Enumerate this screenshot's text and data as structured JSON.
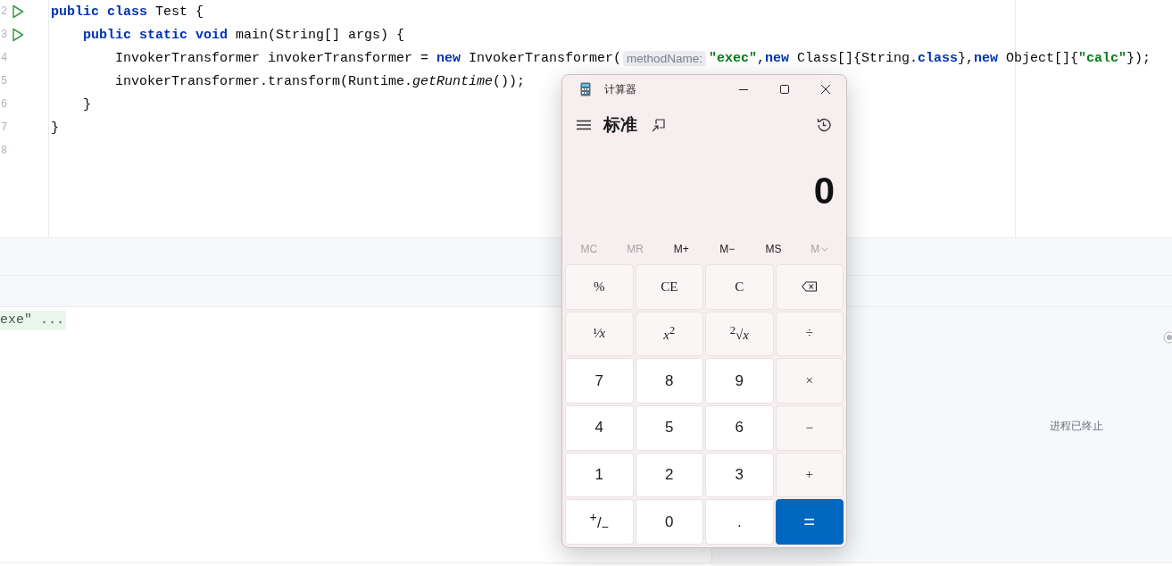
{
  "editor": {
    "lines": [
      {
        "number": "2",
        "run": true,
        "tokens": [
          {
            "kind": "kw",
            "text": "public class"
          },
          {
            "kind": "plain",
            "text": " Test {"
          }
        ],
        "children": [
          {
            "number": "3",
            "run": true,
            "tokens": [
              {
                "kind": "kw",
                "text": "public static void"
              },
              {
                "kind": "plain",
                "text": " main(String[] args) {"
              }
            ],
            "children": [
              {
                "number": "4",
                "run": false,
                "tokens": [
                  {
                    "kind": "plain",
                    "text": "InvokerTransformer invokerTransformer = "
                  },
                  {
                    "kind": "kw",
                    "text": "new"
                  },
                  {
                    "kind": "plain",
                    "text": " InvokerTransformer("
                  },
                  {
                    "kind": "hint",
                    "text": "methodName:"
                  },
                  {
                    "kind": "str",
                    "text": "\"exec\""
                  },
                  {
                    "kind": "plain",
                    "text": ","
                  },
                  {
                    "kind": "kw",
                    "text": "new"
                  },
                  {
                    "kind": "plain",
                    "text": " Class[]{String."
                  },
                  {
                    "kind": "kw",
                    "text": "class"
                  },
                  {
                    "kind": "plain",
                    "text": "},"
                  },
                  {
                    "kind": "kw",
                    "text": "new"
                  },
                  {
                    "kind": "plain",
                    "text": " Object[]{"
                  },
                  {
                    "kind": "str",
                    "text": "\"calc\""
                  },
                  {
                    "kind": "plain",
                    "text": "});"
                  }
                ]
              },
              {
                "number": "5",
                "run": false,
                "tokens": [
                  {
                    "kind": "plain",
                    "text": "invokerTransformer.transform(Runtime."
                  },
                  {
                    "kind": "italic",
                    "text": "getRuntime"
                  },
                  {
                    "kind": "plain",
                    "text": "());"
                  }
                ]
              }
            ]
          },
          {
            "number": "6",
            "run": false,
            "tokens": [
              {
                "kind": "plain",
                "text": "}"
              }
            ]
          }
        ]
      },
      {
        "number": "7",
        "run": false,
        "tokens": [
          {
            "kind": "plain",
            "text": "}"
          }
        ]
      },
      {
        "number": "8",
        "run": false
      }
    ]
  },
  "console": {
    "output": "exe\" ..."
  },
  "side_panel": {
    "status": "进程已终止"
  },
  "calculator": {
    "title": "计算器",
    "mode": "标准",
    "display": "0",
    "memory_buttons": [
      {
        "label": "MC",
        "disabled": true,
        "dropdown": false
      },
      {
        "label": "MR",
        "disabled": true,
        "dropdown": false
      },
      {
        "label": "M+",
        "disabled": false,
        "dropdown": false
      },
      {
        "label": "M−",
        "disabled": false,
        "dropdown": false
      },
      {
        "label": "MS",
        "disabled": false,
        "dropdown": false
      },
      {
        "label": "M",
        "disabled": true,
        "dropdown": true
      }
    ],
    "keys": [
      {
        "label": "%",
        "kind": "function"
      },
      {
        "label": "CE",
        "kind": "function"
      },
      {
        "label": "C",
        "kind": "function"
      },
      {
        "kind": "backspace"
      },
      {
        "label": "¹⁄*x*",
        "kind": "function"
      },
      {
        "label": "*x*$^{2}$",
        "kind": "function"
      },
      {
        "label": "$^{2}$√*x*",
        "kind": "function"
      },
      {
        "label": "÷",
        "kind": "function"
      },
      {
        "label": "7",
        "kind": "digit"
      },
      {
        "label": "8",
        "kind": "digit"
      },
      {
        "label": "9",
        "kind": "digit"
      },
      {
        "label": "×",
        "kind": "function"
      },
      {
        "label": "4",
        "kind": "digit"
      },
      {
        "label": "5",
        "kind": "digit"
      },
      {
        "label": "6",
        "kind": "digit"
      },
      {
        "label": "−",
        "kind": "function"
      },
      {
        "label": "1",
        "kind": "digit"
      },
      {
        "label": "2",
        "kind": "digit"
      },
      {
        "label": "3",
        "kind": "digit"
      },
      {
        "label": "+",
        "kind": "function"
      },
      {
        "label": "$^{+}$/$_{−}$",
        "kind": "digit"
      },
      {
        "label": "0",
        "kind": "digit"
      },
      {
        "label": ".",
        "kind": "digit"
      },
      {
        "label": "=",
        "kind": "equals"
      }
    ]
  }
}
